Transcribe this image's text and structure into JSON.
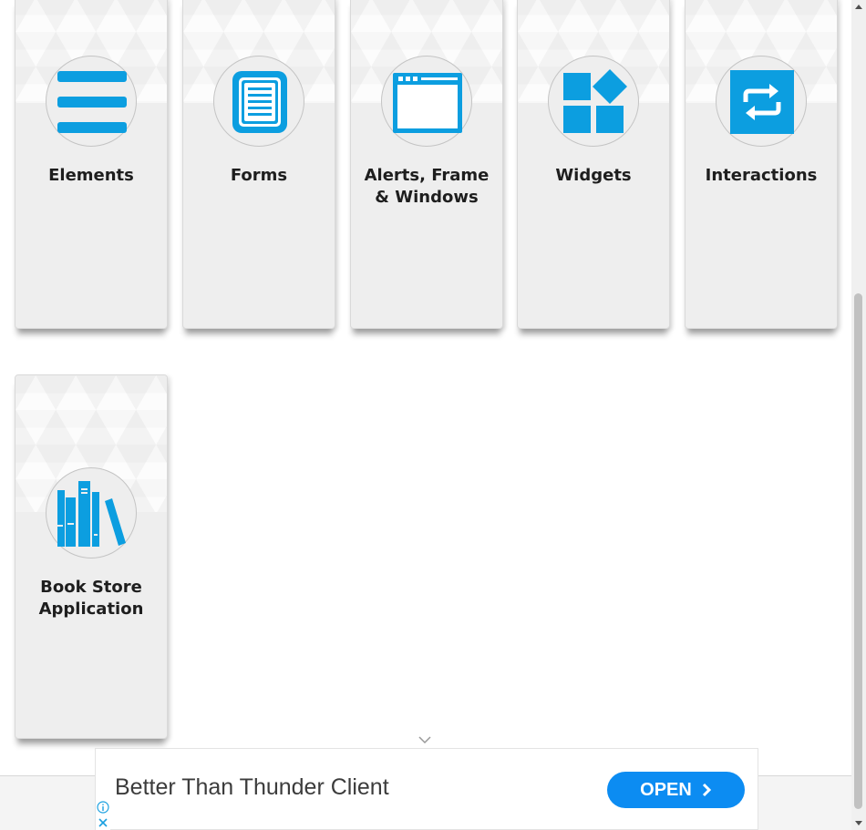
{
  "colors": {
    "accent": "#0c9ee0",
    "card_bg": "#eeeeee",
    "ad_button": "#0c8cf2"
  },
  "cards": [
    {
      "title": "Elements",
      "icon": "hamburger-menu-icon"
    },
    {
      "title": "Forms",
      "icon": "document-form-icon"
    },
    {
      "title": "Alerts, Frame\n& Windows",
      "icon": "browser-window-icon"
    },
    {
      "title": "Widgets",
      "icon": "widget-blocks-icon"
    },
    {
      "title": "Interactions",
      "icon": "repeat-arrows-icon"
    },
    {
      "title": "Book Store\nApplication",
      "icon": "books-icon"
    }
  ],
  "ad": {
    "headline": "Better Than Thunder Client",
    "cta_label": "OPEN",
    "cta_icon": "chevron-right-icon",
    "info_icon": "info-icon",
    "close_icon": "close-icon",
    "collapse_icon": "chevron-down-icon"
  }
}
